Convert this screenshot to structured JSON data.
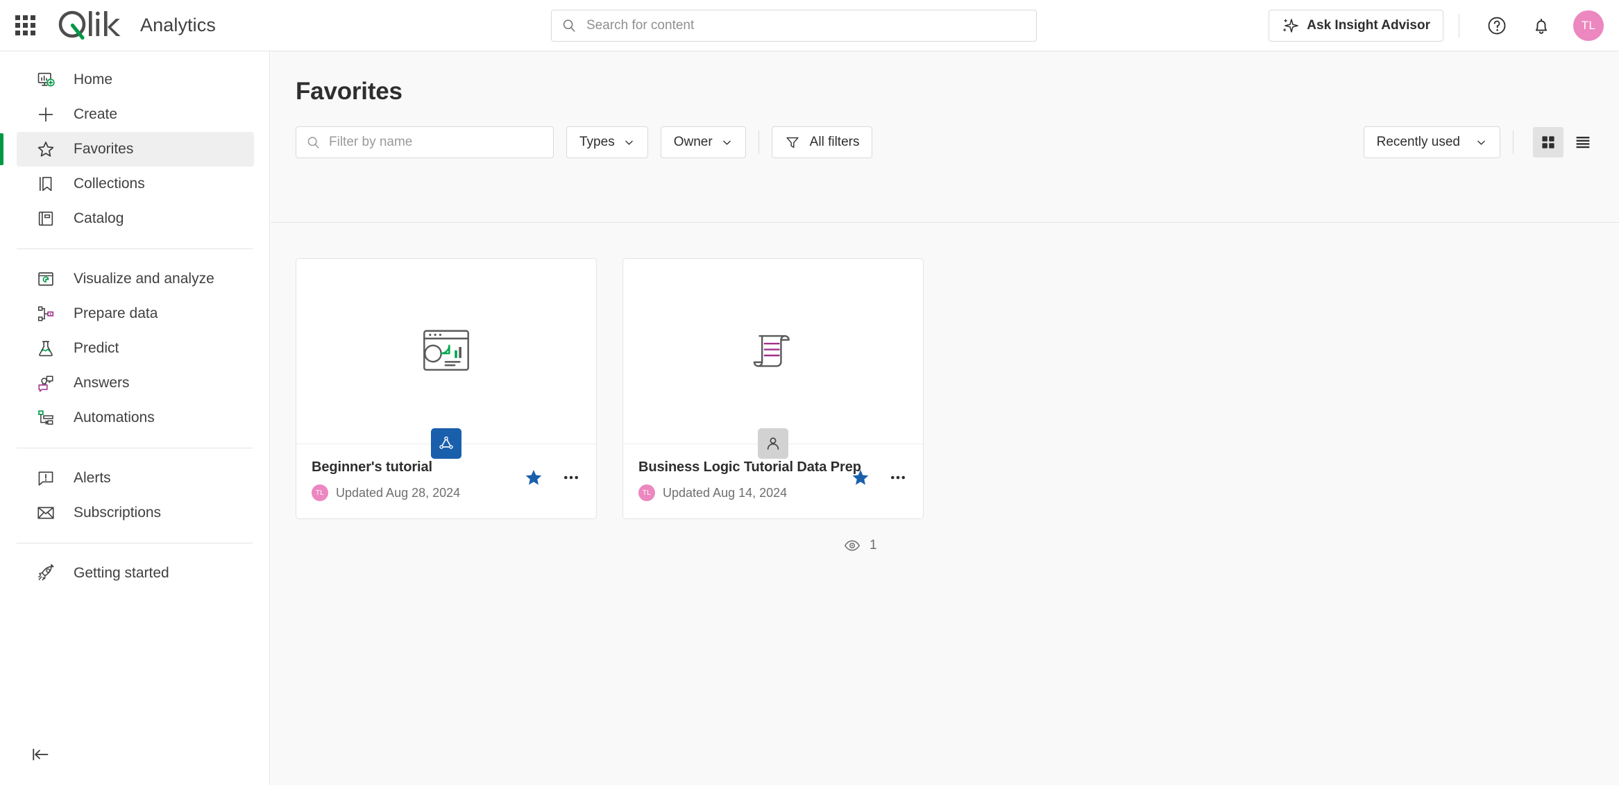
{
  "topbar": {
    "launcher_label": "app-launcher",
    "brand": "Qlik",
    "product": "Analytics",
    "search": {
      "placeholder": "Search for content",
      "value": ""
    },
    "ask_insight_advisor": "Ask Insight Advisor",
    "help_icon": "help-circle-icon",
    "notifications_icon": "bell-icon",
    "avatar_initials": "TL",
    "avatar_color": "#ec87c0"
  },
  "sidebar": {
    "items": [
      {
        "label": "Home",
        "icon": "home-monitor-icon",
        "active": false
      },
      {
        "label": "Create",
        "icon": "plus-icon",
        "active": false
      },
      {
        "label": "Favorites",
        "icon": "star-outline-icon",
        "active": true
      },
      {
        "label": "Collections",
        "icon": "bookmark-icon",
        "active": false
      },
      {
        "label": "Catalog",
        "icon": "catalog-book-icon",
        "active": false
      },
      {
        "label": "Visualize and analyze",
        "icon": "visualize-icon",
        "active": false
      },
      {
        "label": "Prepare data",
        "icon": "prepare-data-icon",
        "active": false
      },
      {
        "label": "Predict",
        "icon": "flask-icon",
        "active": false
      },
      {
        "label": "Answers",
        "icon": "answers-chat-icon",
        "active": false
      },
      {
        "label": "Automations",
        "icon": "automations-icon",
        "active": false
      },
      {
        "label": "Alerts",
        "icon": "alert-bubble-icon",
        "active": false
      },
      {
        "label": "Subscriptions",
        "icon": "envelope-icon",
        "active": false
      },
      {
        "label": "Getting started",
        "icon": "rocket-icon",
        "active": false
      }
    ],
    "collapse_icon": "collapse-sidebar-icon",
    "active_accent": "#009845"
  },
  "main": {
    "title": "Favorites",
    "filter_placeholder": "Filter by name",
    "filter_value": "",
    "types_label": "Types",
    "owner_label": "Owner",
    "all_filters_label": "All filters",
    "sort_label": "Recently used",
    "grid_view_icon": "grid-view-icon",
    "list_view_icon": "list-view-icon",
    "active_view": "grid",
    "views_count": "1",
    "views_icon": "eye-icon"
  },
  "cards": [
    {
      "name": "Beginner's tutorial",
      "updated": "Updated Aug 28, 2024",
      "owner_initials": "TL",
      "thumb_icon": "chart-window-icon",
      "badge_icon": "qlik-sense-app-icon",
      "badge_type": "app",
      "badge_color": "#1a5fac",
      "favorited": true,
      "star_color": "#1a5fac",
      "more_icon": "more-horizontal-icon"
    },
    {
      "name": "Business Logic Tutorial Data Prep",
      "updated": "Updated Aug 14, 2024",
      "owner_initials": "TL",
      "thumb_icon": "script-scroll-icon",
      "badge_icon": "person-icon",
      "badge_type": "person",
      "badge_color": "#d2d2d2",
      "favorited": true,
      "star_color": "#1a5fac",
      "more_icon": "more-horizontal-icon"
    }
  ]
}
